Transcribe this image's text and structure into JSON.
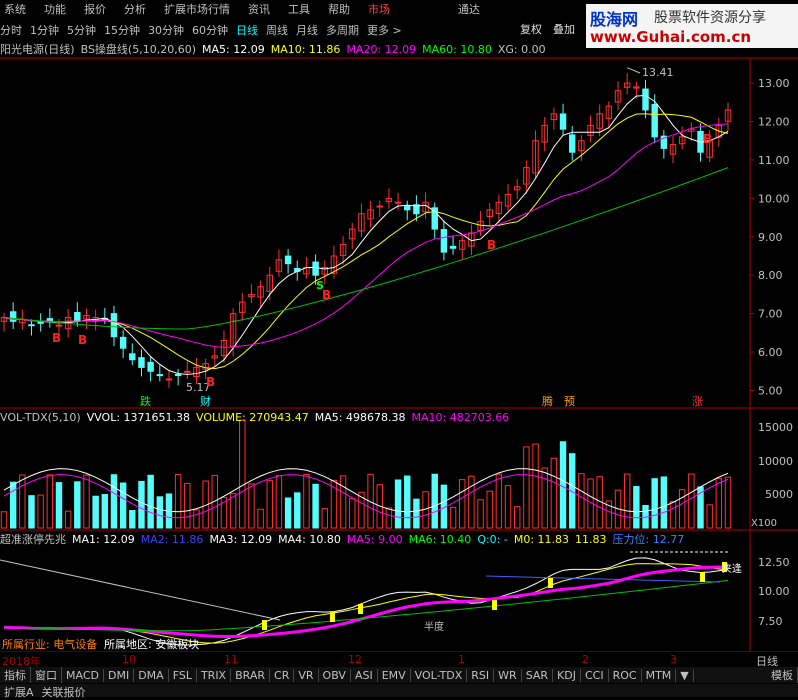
{
  "menu": {
    "items": [
      "系统",
      "功能",
      "报价",
      "分析",
      "扩展市场行情",
      "资讯",
      "工具",
      "帮助"
    ],
    "selected": "市场",
    "right": "通达"
  },
  "periods": {
    "items": [
      "分时",
      "1分钟",
      "5分钟",
      "15分钟",
      "30分钟",
      "60分钟",
      "日线",
      "周线",
      "月线",
      "多周期",
      "更多 >"
    ],
    "active": "日线"
  },
  "buttons": {
    "rights": "复权",
    "overlay": "叠加"
  },
  "logo": {
    "line1": "股海网",
    "line1b": "股票软件资源分享",
    "line2": "www.Guhai.com.cn"
  },
  "main_panel": {
    "stock": "阳光电源(日线)",
    "indicator": "BS操盘线(5,10,20,60)",
    "ma5": "MA5: 12.09",
    "ma10": "MA10: 11.86",
    "ma20": "MA20: 12.09",
    "ma60": "MA60: 10.80",
    "xg": "XG: 0.00",
    "high_label": "13.41",
    "low_label": "5.17",
    "y_ticks": [
      "13.00",
      "12.00",
      "11.00",
      "10.00",
      "9.00",
      "8.00",
      "7.00",
      "6.00",
      "5.00"
    ],
    "markers": {
      "b": "B",
      "s": "S",
      "die": "跌",
      "cai": "财",
      "teng": "腾",
      "yu": "预",
      "zhang": "涨",
      "dash": "-"
    }
  },
  "vol_panel": {
    "name": "VOL-TDX(5,10)",
    "vvol": "VVOL: 1371651.38",
    "volume": "VOLUME: 270943.47",
    "ma5": "MA5: 498678.38",
    "ma10": "MA10: 482703.66",
    "y_ticks": [
      "15000",
      "10000",
      "5000"
    ],
    "unit": "X100"
  },
  "sig_panel": {
    "name": "超准涨停先兆",
    "ma1": "MA1: 12.09",
    "ma2": "MA2: 11.86",
    "ma3": "MA3: 12.09",
    "ma4": "MA4: 10.80",
    "ma5": "MA5: 9.00",
    "ma6": "MA6: 10.40",
    "q": "Q:0: -",
    "m0": "M0: 11.83",
    "m0b": "11.83",
    "pressure": "压力位: 12.77",
    "y_ticks": [
      "12.50",
      "10.00",
      "7.50"
    ],
    "label_banjia": "半度",
    "label_jia": "夹逢",
    "industry": "所属行业: 电气设备",
    "region": "所属地区: 安徽板块"
  },
  "dates": {
    "items": [
      "2018年",
      "10",
      "11",
      "12",
      "1",
      "2",
      "3"
    ],
    "period": "日线"
  },
  "bottom_tabs": {
    "items": [
      "指标",
      "窗口",
      "MACD",
      "DMI",
      "DMA",
      "FSL",
      "TRIX",
      "BRAR",
      "CR",
      "VR",
      "OBV",
      "ASI",
      "EMV",
      "VOL-TDX",
      "RSI",
      "WR",
      "SAR",
      "KDJ",
      "CCI",
      "ROC",
      "MTM",
      "▼"
    ],
    "template": "模板"
  },
  "status": {
    "items": [
      "扩展A",
      "关联报价"
    ]
  },
  "colors": {
    "up": "#ff3030",
    "down": "#54fcfc",
    "ma5": "#ffffff",
    "ma10": "#ffff00",
    "ma20": "#ff00ff",
    "ma60": "#00c000",
    "axis": "#b00000"
  },
  "chart_data": {
    "type": "candlestick",
    "ohlc_close": [
      6.9,
      6.8,
      6.85,
      6.7,
      6.75,
      6.8,
      6.7,
      6.9,
      6.8,
      6.95,
      6.9,
      6.85,
      6.4,
      6.1,
      5.8,
      5.6,
      5.5,
      5.4,
      5.3,
      5.4,
      5.5,
      5.6,
      5.7,
      5.9,
      6.3,
      7.0,
      7.3,
      7.5,
      7.7,
      8.0,
      8.4,
      8.3,
      8.1,
      8.2,
      8.0,
      8.2,
      8.5,
      8.8,
      9.2,
      9.6,
      9.7,
      9.8,
      10.0,
      9.9,
      9.7,
      9.6,
      9.9,
      9.2,
      8.6,
      8.7,
      8.9,
      9.1,
      9.4,
      9.7,
      9.9,
      10.1,
      10.3,
      10.8,
      11.5,
      11.9,
      12.2,
      11.8,
      11.2,
      11.5,
      11.9,
      12.2,
      12.4,
      12.8,
      13.0,
      12.9,
      12.3,
      11.6,
      11.3,
      11.4,
      11.6,
      11.8,
      11.2,
      11.5,
      11.9,
      12.3
    ],
    "ma60_end": 10.8,
    "ylim": [
      4.7,
      13.6
    ]
  }
}
